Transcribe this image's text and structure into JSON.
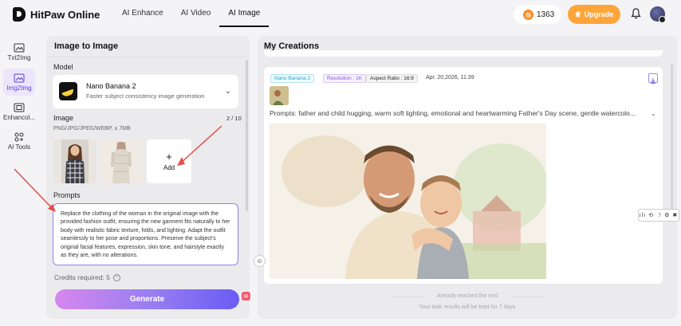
{
  "app": {
    "logo_text": "HitPaw Online"
  },
  "nav": {
    "items": [
      "AI Enhance",
      "AI Video",
      "AI Image"
    ],
    "active": "AI Image"
  },
  "header": {
    "credits": "1363",
    "upgrade_label": "Upgrade"
  },
  "sidebar": {
    "items": [
      {
        "label": "Txt2Img",
        "icon": "text-to-image-icon"
      },
      {
        "label": "Img2Img",
        "icon": "image-to-image-icon",
        "active": true
      },
      {
        "label": "Enhancol...",
        "icon": "enhance-icon"
      },
      {
        "label": "AI Tools",
        "icon": "ai-tools-icon"
      }
    ]
  },
  "left_panel": {
    "title": "Image to Image",
    "model_label": "Model",
    "model": {
      "name": "Nano Banana 2",
      "description": "Faster subject consistency image generation"
    },
    "image_label": "Image",
    "image_count": "2 / 10",
    "image_hint": "PNG/JPG/JPEG/WEBP, ≤ 7MB",
    "add_label": "Add",
    "prompts_label": "Prompts",
    "prompt_text": "Replace the clothing of the woman in the original image with the provided fashion outfit, ensuring the new garment fits naturally to her body with realistic fabric texture, folds, and lighting. Adapt the outfit seamlessly to her pose and proportions. Preserve the subject's original facial features, expression, skin tone, and hairstyle exactly as they are, with no alterations.",
    "credits_required": "Credits required: 5",
    "generate_label": "Generate"
  },
  "right_panel": {
    "title": "My Creations",
    "card": {
      "tags": [
        "Nano Banana 2",
        "Resolution : 1K",
        "Aspect Ratio : 16:9"
      ],
      "date": "Apr. 20,2026, 11:39",
      "prompt": "Prompts: father and child hugging, warm soft lighting, emotional and heartwarming Father's Day scene, gentle watercolo..."
    },
    "end_text": "Already reached the end",
    "retention_text": "Your task results will be kept for 7 days"
  },
  "colors": {
    "accent": "#6a5cf5",
    "upgrade": "#ffa53a",
    "arrow": "#e0504a"
  }
}
